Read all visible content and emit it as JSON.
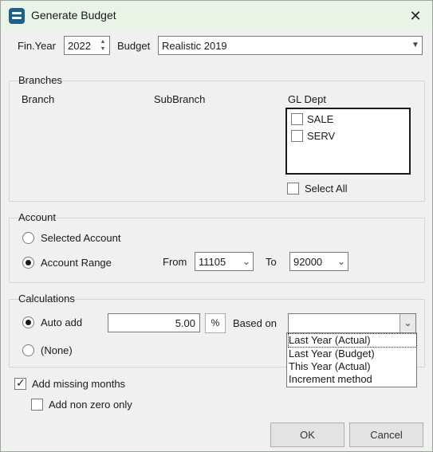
{
  "window": {
    "title": "Generate Budget",
    "close_glyph": "✕"
  },
  "top": {
    "fin_year_label": "Fin.Year",
    "fin_year_value": "2022",
    "budget_label": "Budget",
    "budget_value": "Realistic 2019"
  },
  "branches": {
    "group_title": "Branches",
    "branch_header": "Branch",
    "subbranch_header": "SubBranch",
    "gl_dept_header": "GL Dept",
    "gl_depts": [
      {
        "label": "SALE",
        "checked": false
      },
      {
        "label": "SERV",
        "checked": false
      }
    ],
    "select_all_label": "Select All"
  },
  "account": {
    "group_title": "Account",
    "selected_account_label": "Selected Account",
    "account_range_label": "Account Range",
    "from_label": "From",
    "from_value": "11105",
    "to_label": "To",
    "to_value": "92000",
    "selected_option": "Account Range"
  },
  "calculations": {
    "group_title": "Calculations",
    "auto_add_label": "Auto add",
    "auto_add_value": "5.00",
    "percent_button": "%",
    "none_label": "(None)",
    "based_on_label": "Based on",
    "based_on_value": "",
    "based_on_options": [
      "Last Year (Actual)",
      "Last Year (Budget)",
      "This Year (Actual)",
      "Increment method"
    ],
    "selected_option": "Auto add"
  },
  "options": {
    "add_missing_months_label": "Add missing months",
    "add_missing_months_checked": true,
    "add_non_zero_only_label": "Add non zero only",
    "add_non_zero_only_checked": false
  },
  "buttons": {
    "ok": "OK",
    "cancel": "Cancel"
  }
}
